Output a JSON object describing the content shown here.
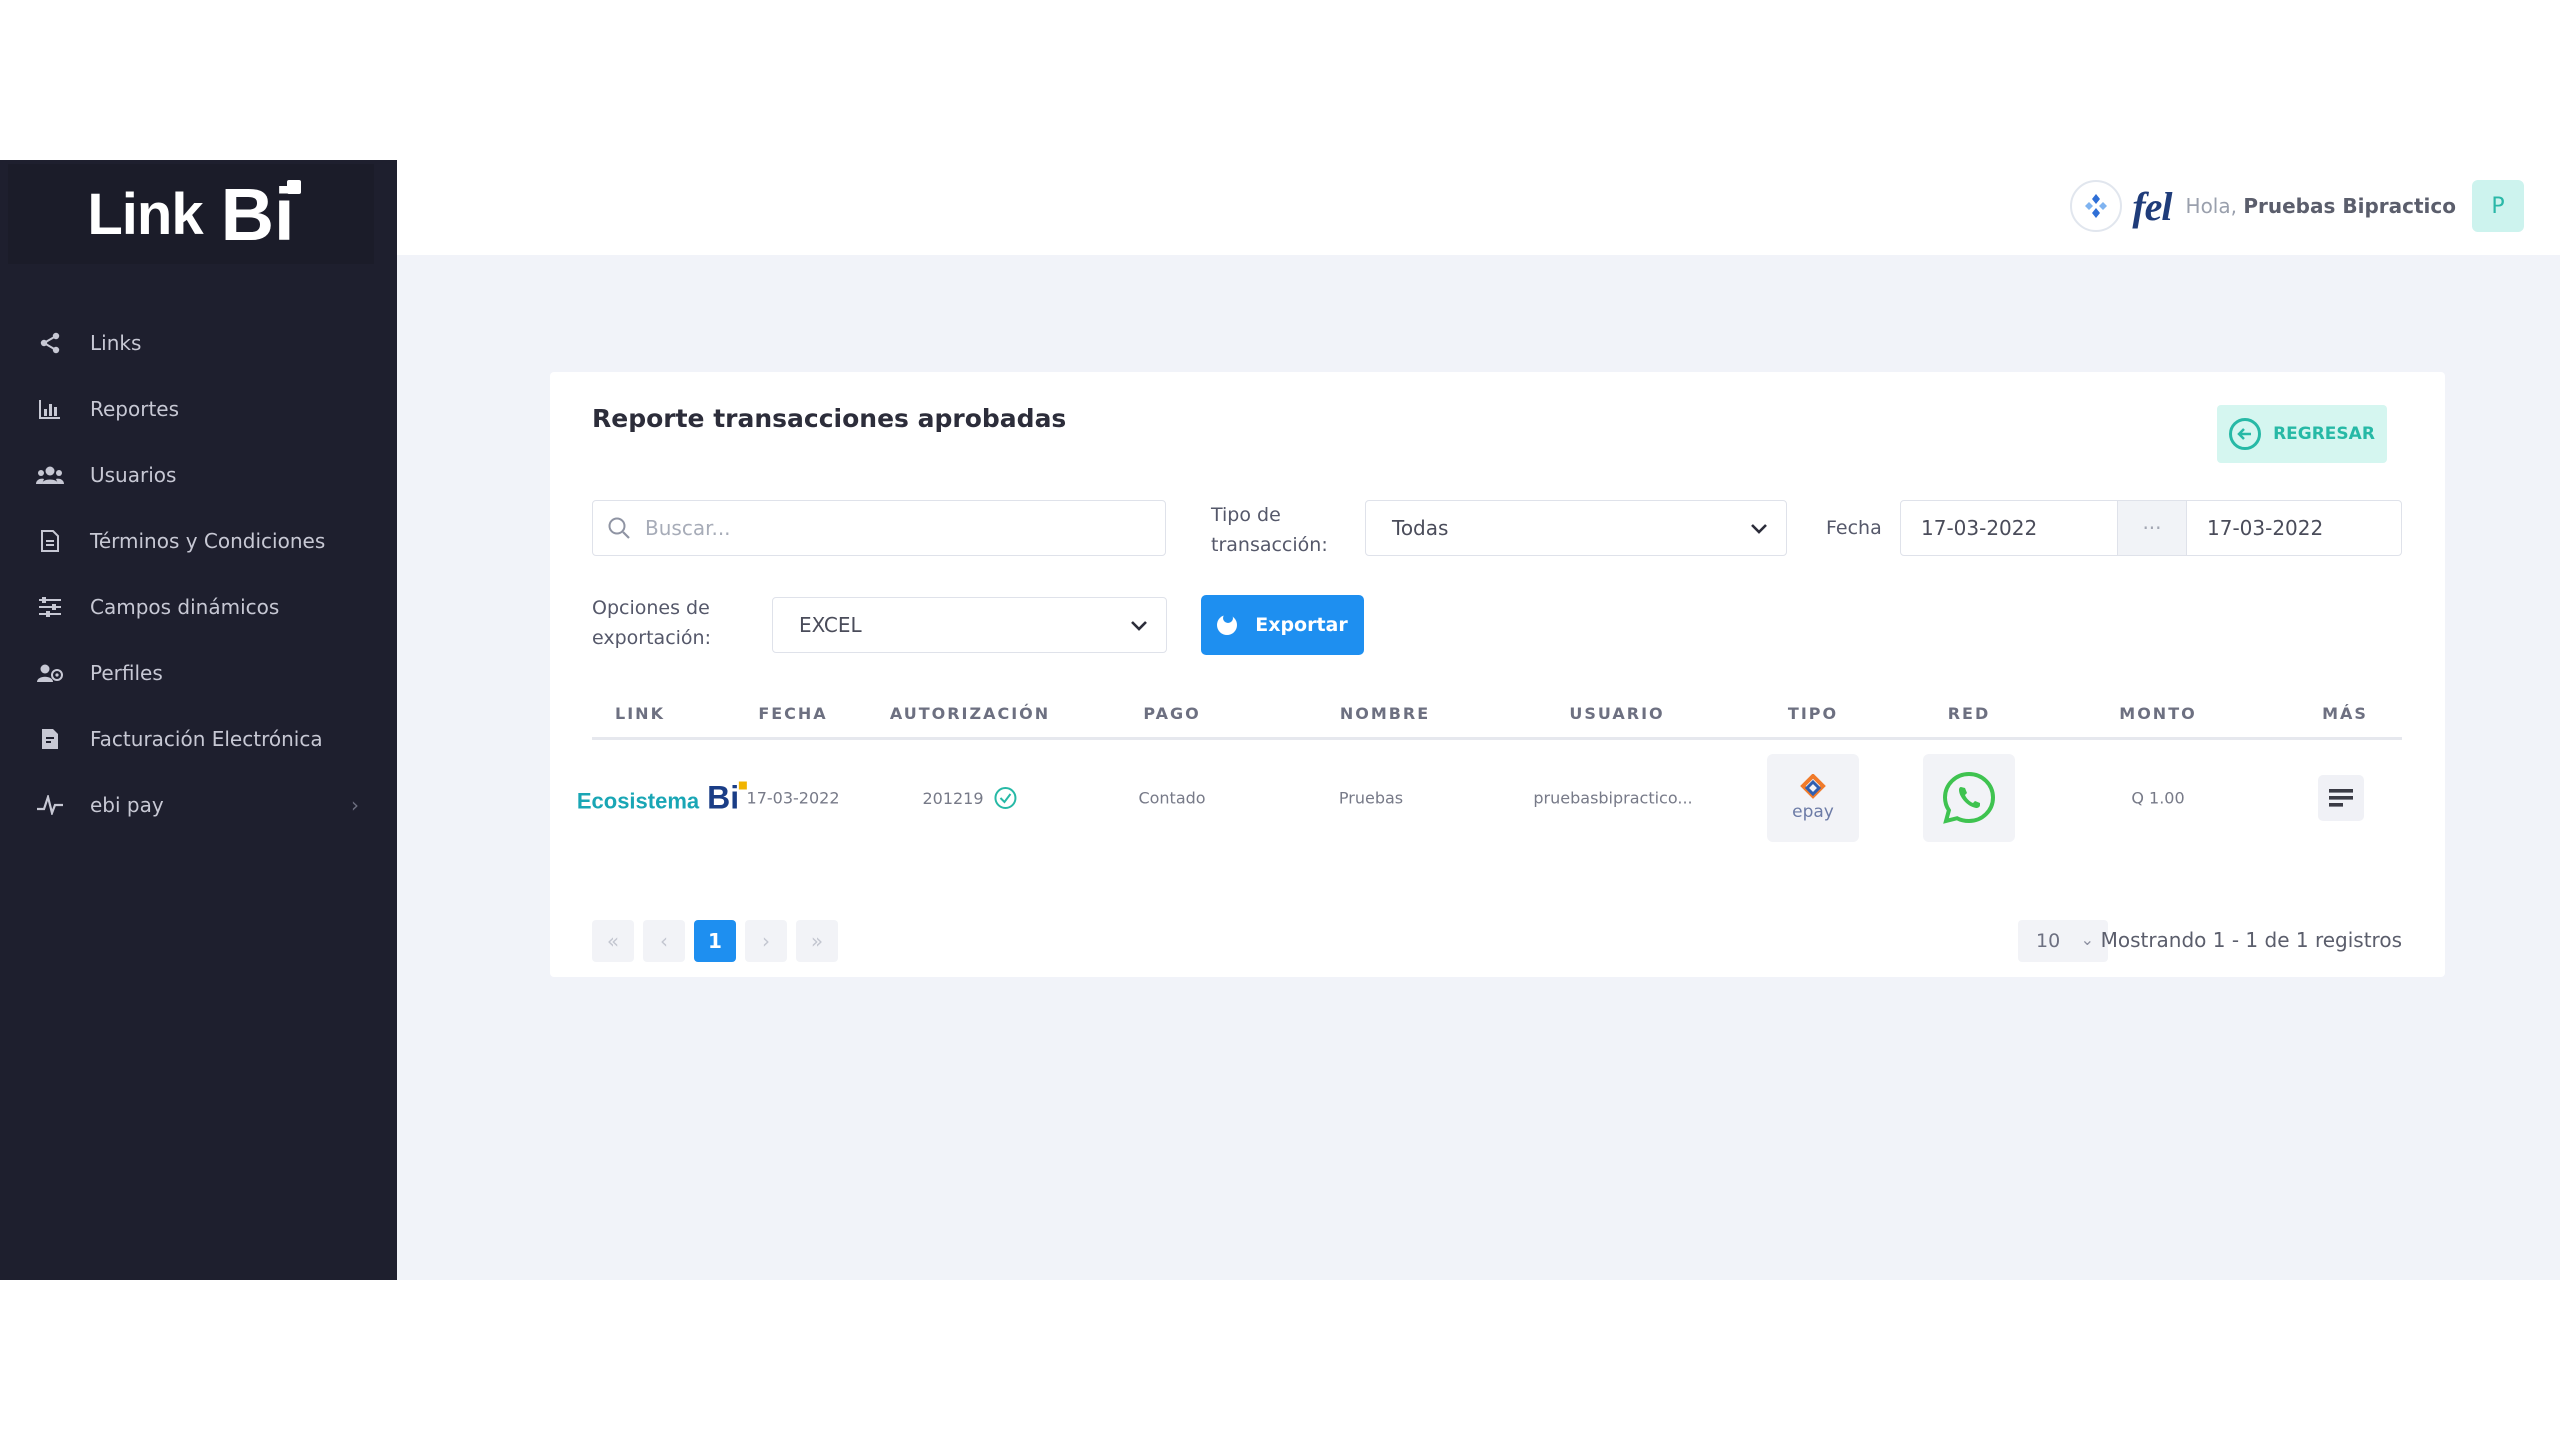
{
  "brand": {
    "logo_text": "Link",
    "logo_mark": "Bi"
  },
  "sidebar": {
    "items": [
      {
        "label": "Links",
        "icon": "share-icon"
      },
      {
        "label": "Reportes",
        "icon": "bar-chart-icon"
      },
      {
        "label": "Usuarios",
        "icon": "users-icon"
      },
      {
        "label": "Términos y Condiciones",
        "icon": "document-icon"
      },
      {
        "label": "Campos dinámicos",
        "icon": "sliders-icon"
      },
      {
        "label": "Perfiles",
        "icon": "profiles-icon"
      },
      {
        "label": "Facturación Electrónica",
        "icon": "invoice-icon"
      },
      {
        "label": "ebi pay",
        "icon": "ebipay-icon"
      }
    ]
  },
  "header": {
    "fel_logo": "fel",
    "greeting_prefix": "Hola,",
    "user_name": "Pruebas Bipractico",
    "avatar_letter": "P"
  },
  "report": {
    "title": "Reporte transacciones aprobadas",
    "back_label": "REGRESAR",
    "search_placeholder": "Buscar...",
    "tipo_label_1": "Tipo de",
    "tipo_label_2": "transacción:",
    "tipo_value": "Todas",
    "fecha_label": "Fecha",
    "fecha_from": "17-03-2022",
    "fecha_sep": "···",
    "fecha_to": "17-03-2022",
    "export_label_1": "Opciones de",
    "export_label_2": "exportación:",
    "export_value": "EXCEL",
    "export_button": "Exportar"
  },
  "table": {
    "headers": [
      "LINK",
      "FECHA",
      "AUTORIZACIÓN",
      "PAGO",
      "NOMBRE",
      "USUARIO",
      "TIPO",
      "RED",
      "MONTO",
      "MÁS"
    ],
    "rows": [
      {
        "link_brand": "Ecosistema",
        "link_mark": "Bi",
        "fecha": "17-03-2022",
        "autorizacion": "201219",
        "pago": "Contado",
        "nombre": "Pruebas",
        "usuario": "pruebasbipractico...",
        "tipo_logo": "epay",
        "red_icon": "whatsapp-icon",
        "monto": "Q 1.00"
      }
    ]
  },
  "pagination": {
    "current_page": "1",
    "per_page": "10",
    "summary": "Mostrando 1 - 1 de 1 registros"
  },
  "colors": {
    "sidebar_bg": "#1e1f2e",
    "accent_blue": "#1e8ff0",
    "accent_teal": "#27b9a6",
    "content_bg": "#f1f3f9"
  }
}
